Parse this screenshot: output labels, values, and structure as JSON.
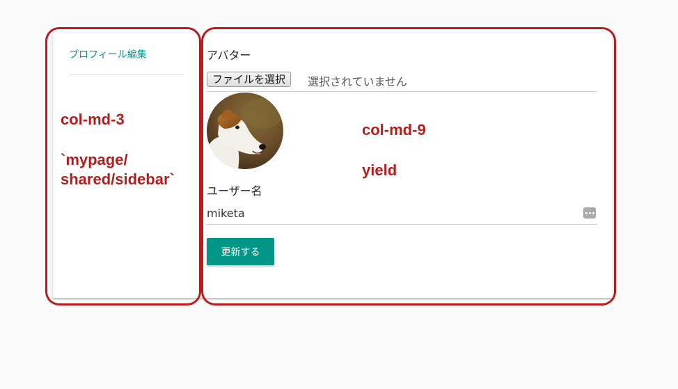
{
  "sidebar": {
    "link_label": "プロフィール編集"
  },
  "form": {
    "avatar_label": "アバター",
    "file_button_label": "ファイルを選択",
    "file_status": "選択されていません",
    "avatar_image": "avatar-image (jack russell terrier photo)",
    "username_label": "ユーザー名",
    "username_value": "miketa",
    "autofill_icon": "autofill-dots-icon",
    "submit_label": "更新する"
  },
  "annotations": {
    "sidebar_grid": "col-md-3",
    "sidebar_partial_line1": "`mypage/",
    "sidebar_partial_line2": "shared/sidebar`",
    "main_grid": "col-md-9",
    "main_yield": "yield"
  },
  "colors": {
    "accent": "#009688",
    "annotation": "#b71c1c",
    "background": "#fafafa"
  }
}
